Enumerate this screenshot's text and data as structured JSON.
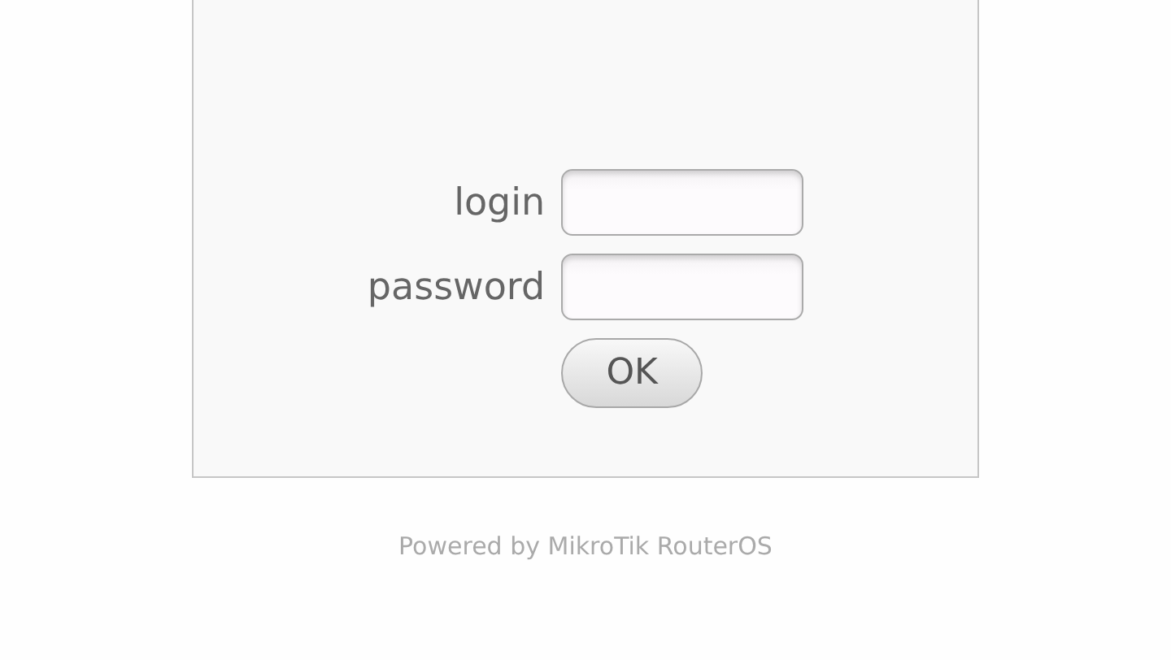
{
  "form": {
    "fields": [
      {
        "label": "login"
      },
      {
        "label": "password"
      }
    ],
    "button": "OK"
  },
  "footer": "Powered by MikroTik RouterOS"
}
